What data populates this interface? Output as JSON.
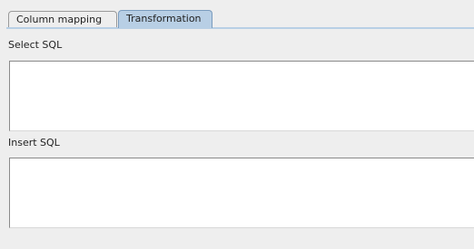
{
  "tabs": [
    {
      "label": "Column mapping",
      "active": false
    },
    {
      "label": "Transformation",
      "active": true
    }
  ],
  "transformation": {
    "select_sql_label": "Select SQL",
    "select_sql_value": "",
    "insert_sql_label": "Insert SQL",
    "insert_sql_value": ""
  },
  "colors": {
    "active_tab": "#b8cfe5",
    "background": "#eeeeee",
    "field_background": "#ffffff"
  }
}
